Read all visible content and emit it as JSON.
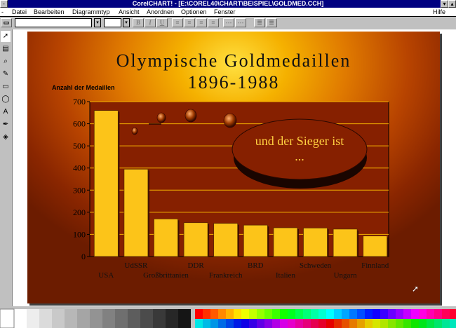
{
  "window": {
    "title": "CorelCHART! - [E:\\COREL40\\CHART\\BEISPIEL\\GOLDMED.CCH]"
  },
  "menu": {
    "items": [
      "Datei",
      "Bearbeiten",
      "Diagrammtyp",
      "Ansicht",
      "Anordnen",
      "Optionen",
      "Fenster"
    ],
    "help": "Hilfe"
  },
  "toolbar": {
    "bold": "B",
    "italic": "I",
    "underline": "U"
  },
  "chart_data": {
    "type": "bar",
    "title": "Olympische Goldmedaillen",
    "subtitle": "1896-1988",
    "ylabel": "Anzahl der Medaillen",
    "categories": [
      "USA",
      "UdSSR",
      "Großbrittanien",
      "DDR",
      "Frankreich",
      "BRD",
      "Italien",
      "Schweden",
      "Ungarn",
      "Finnland"
    ],
    "values": [
      660,
      395,
      170,
      153,
      150,
      142,
      130,
      129,
      124,
      93
    ],
    "ylim": [
      0,
      700
    ],
    "yticks": [
      "0",
      "100",
      "200",
      "300",
      "400",
      "500",
      "600",
      "700"
    ],
    "annotation": "und der Sieger ist ...",
    "colors": {
      "bar": "#fcc419",
      "bar_edge": "#5a2a00",
      "plot_bg": "#862000",
      "grid": "#f5b300"
    }
  }
}
